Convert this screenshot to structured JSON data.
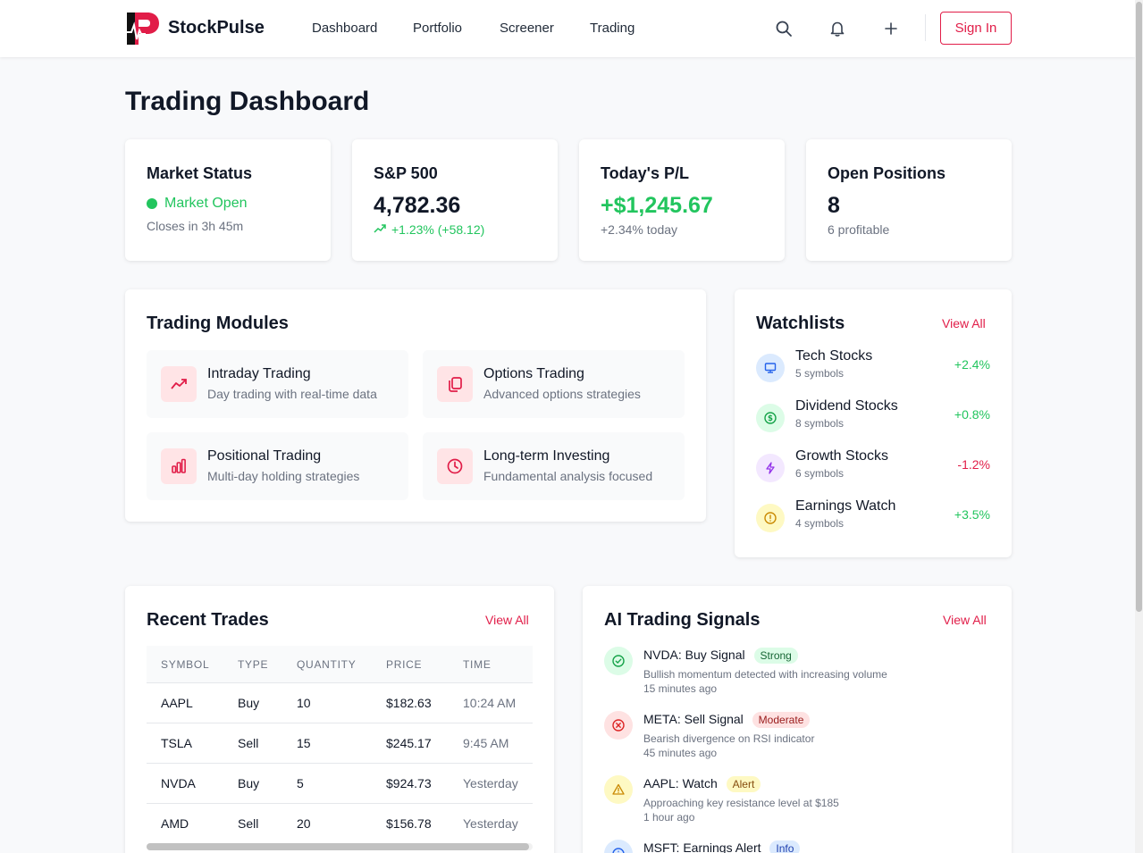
{
  "header": {
    "brand": "StockPulse",
    "nav": [
      "Dashboard",
      "Portfolio",
      "Screener",
      "Trading"
    ],
    "sign_in": "Sign In",
    "icons": [
      "search-icon",
      "bell-icon",
      "plus-icon"
    ]
  },
  "page_title": "Trading Dashboard",
  "stats": {
    "market": {
      "title": "Market Status",
      "status": "Market Open",
      "sub": "Closes in 3h 45m"
    },
    "sp500": {
      "title": "S&P 500",
      "value": "4,782.36",
      "change": "+1.23% (+58.12)"
    },
    "pl": {
      "title": "Today's P/L",
      "value": "+$1,245.67",
      "sub": "+2.34% today"
    },
    "positions": {
      "title": "Open Positions",
      "value": "8",
      "sub": "6 profitable"
    }
  },
  "modules": {
    "title": "Trading Modules",
    "items": [
      {
        "title": "Intraday Trading",
        "desc": "Day trading with real-time data",
        "icon": "trending-up-icon"
      },
      {
        "title": "Options Trading",
        "desc": "Advanced options strategies",
        "icon": "copy-icon"
      },
      {
        "title": "Positional Trading",
        "desc": "Multi-day holding strategies",
        "icon": "bar-chart-icon"
      },
      {
        "title": "Long-term Investing",
        "desc": "Fundamental analysis focused",
        "icon": "clock-icon"
      }
    ]
  },
  "watchlists": {
    "title": "Watchlists",
    "view_all": "View All",
    "items": [
      {
        "name": "Tech Stocks",
        "count": "5 symbols",
        "change": "+2.4%",
        "icon": "monitor-icon"
      },
      {
        "name": "Dividend Stocks",
        "count": "8 symbols",
        "change": "+0.8%",
        "icon": "dollar-icon"
      },
      {
        "name": "Growth Stocks",
        "count": "6 symbols",
        "change": "-1.2%",
        "icon": "lightning-icon"
      },
      {
        "name": "Earnings Watch",
        "count": "4 symbols",
        "change": "+3.5%",
        "icon": "alert-circle-icon"
      }
    ]
  },
  "trades": {
    "title": "Recent Trades",
    "view_all": "View All",
    "columns": [
      "SYMBOL",
      "TYPE",
      "QUANTITY",
      "PRICE",
      "TIME"
    ],
    "rows": [
      {
        "symbol": "AAPL",
        "type": "Buy",
        "qty": "10",
        "price": "$182.63",
        "time": "10:24 AM"
      },
      {
        "symbol": "TSLA",
        "type": "Sell",
        "qty": "15",
        "price": "$245.17",
        "time": "9:45 AM"
      },
      {
        "symbol": "NVDA",
        "type": "Buy",
        "qty": "5",
        "price": "$924.73",
        "time": "Yesterday"
      },
      {
        "symbol": "AMD",
        "type": "Sell",
        "qty": "20",
        "price": "$156.78",
        "time": "Yesterday"
      }
    ]
  },
  "signals": {
    "title": "AI Trading Signals",
    "view_all": "View All",
    "items": [
      {
        "title": "NVDA: Buy Signal",
        "badge": "Strong",
        "desc": "Bullish momentum detected with increasing volume",
        "time": "15 minutes ago",
        "icon": "check-circle-icon"
      },
      {
        "title": "META: Sell Signal",
        "badge": "Moderate",
        "desc": "Bearish divergence on RSI indicator",
        "time": "45 minutes ago",
        "icon": "x-circle-icon"
      },
      {
        "title": "AAPL: Watch",
        "badge": "Alert",
        "desc": "Approaching key resistance level at $185",
        "time": "1 hour ago",
        "icon": "warning-icon"
      },
      {
        "title": "MSFT: Earnings Alert",
        "badge": "Info",
        "desc": "",
        "time": "",
        "icon": "info-icon"
      }
    ]
  },
  "colors": {
    "accent": "#e11d48",
    "positive": "#22c55e",
    "negative": "#ef4444"
  }
}
